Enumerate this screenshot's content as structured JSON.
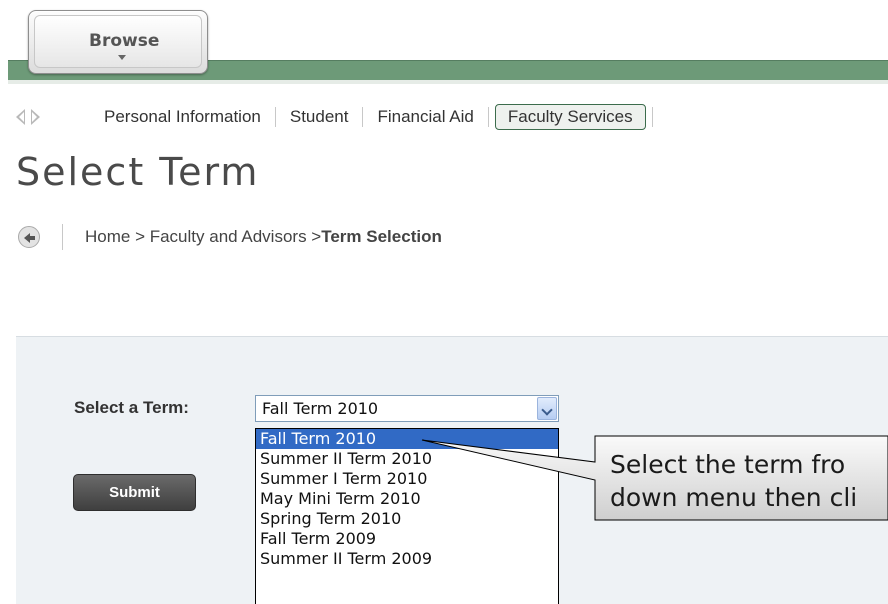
{
  "header": {
    "browse_label": "Browse"
  },
  "nav": {
    "items": [
      {
        "label": "Personal Information"
      },
      {
        "label": "Student"
      },
      {
        "label": "Financial Aid"
      },
      {
        "label": "Faculty Services"
      }
    ]
  },
  "page": {
    "title": "Select Term"
  },
  "breadcrumb": {
    "path": "Home > Faculty and Advisors > ",
    "current": "Term Selection"
  },
  "form": {
    "term_label": "Select a Term:",
    "selected_term": "Fall Term 2010",
    "submit_label": "Submit",
    "options": [
      "Fall Term 2010",
      "Summer II Term 2010",
      "Summer I Term 2010",
      "May Mini Term 2010",
      "Spring Term 2010",
      "Fall Term 2009",
      "Summer II Term 2009"
    ]
  },
  "callout": {
    "line1": "Select the term fro",
    "line2": "down menu then cli"
  },
  "colors": {
    "green_bar": "#6d9a78",
    "selected_option": "#316ac5"
  }
}
